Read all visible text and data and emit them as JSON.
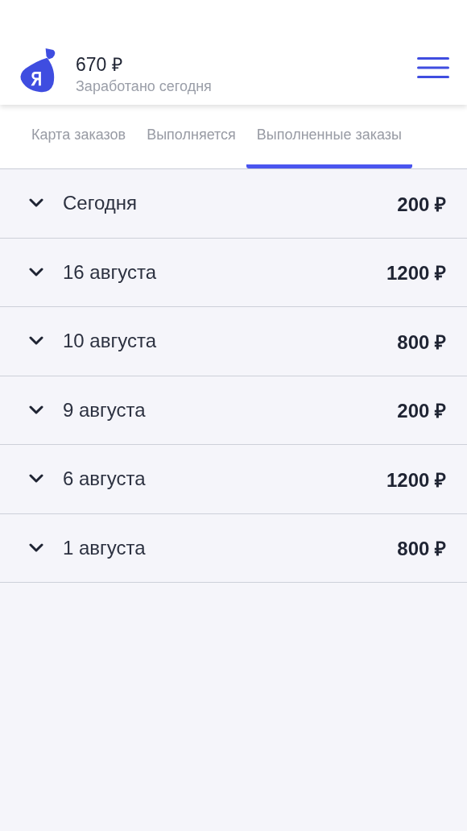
{
  "header": {
    "amount": "670 ₽",
    "subtitle": "Заработано сегодня"
  },
  "tabs": [
    {
      "label": "Карта заказов",
      "selected": false
    },
    {
      "label": "Выполняется",
      "selected": false
    },
    {
      "label": "Выполненные заказы",
      "selected": true
    }
  ],
  "days": [
    {
      "date": "Сегодня",
      "total": "200 ₽",
      "expanded": false
    },
    {
      "date": "16 августа",
      "total": "1200 ₽",
      "expanded": false
    },
    {
      "date": "10 августа",
      "total": "800 ₽",
      "expanded": false
    },
    {
      "date": "9 августа",
      "total": "200 ₽",
      "expanded": false
    },
    {
      "date": "6 августа",
      "total": "1200 ₽",
      "expanded": false
    },
    {
      "date": "1 августа",
      "total": "800 ₽",
      "expanded": false
    }
  ]
}
